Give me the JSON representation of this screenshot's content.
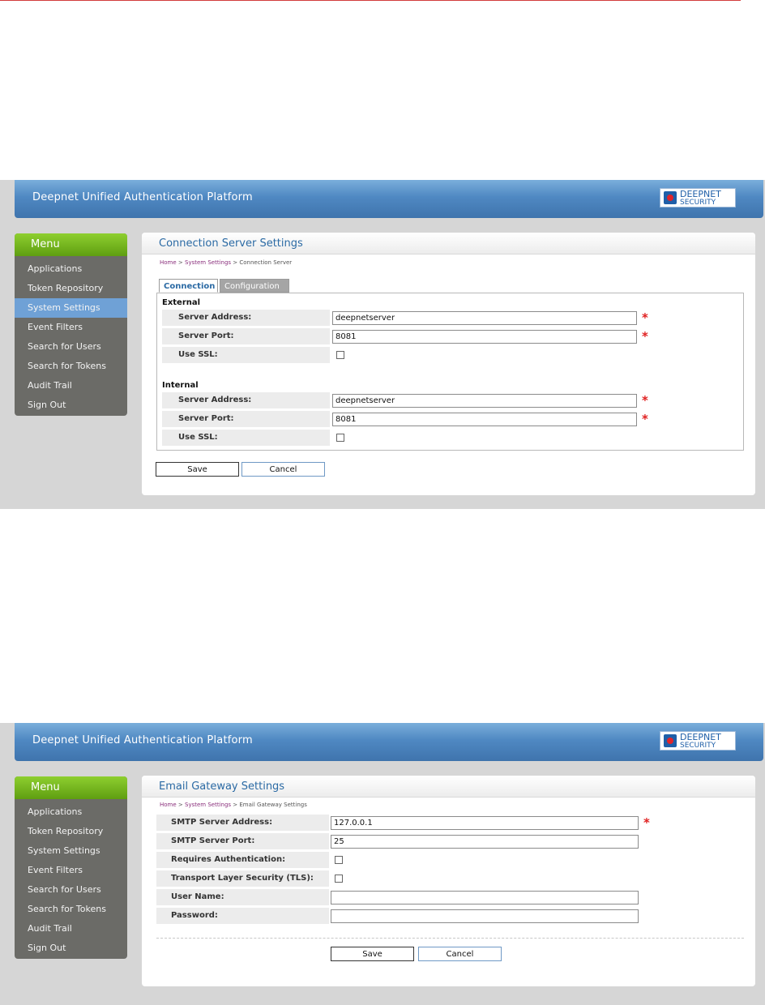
{
  "app_title": "Deepnet Unified Authentication Platform",
  "logo": {
    "line1": "DEEPNET",
    "line2": "SECURITY"
  },
  "menu": {
    "title": "Menu",
    "items": [
      "Applications",
      "Token Repository",
      "System Settings",
      "Event Filters",
      "Search for Users",
      "Search for Tokens",
      "Audit Trail",
      "Sign Out"
    ],
    "active_index_screen1": 2
  },
  "screen1": {
    "page_title": "Connection Server Settings",
    "breadcrumb": {
      "home": "Home",
      "sep": " > ",
      "section": "System Settings",
      "current": "Connection Server"
    },
    "tabs": [
      {
        "label": "Connection",
        "active": true
      },
      {
        "label": "Configuration",
        "active": false
      }
    ],
    "external": {
      "heading": "External",
      "server_address_label": "Server Address:",
      "server_address_value": "deepnetserver",
      "server_port_label": "Server Port:",
      "server_port_value": "8081",
      "use_ssl_label": "Use SSL:",
      "use_ssl_checked": false
    },
    "internal": {
      "heading": "Internal",
      "server_address_label": "Server Address:",
      "server_address_value": "deepnetserver",
      "server_port_label": "Server Port:",
      "server_port_value": "8081",
      "use_ssl_label": "Use SSL:",
      "use_ssl_checked": false
    },
    "required_mark": "*",
    "save_label": "Save",
    "cancel_label": "Cancel"
  },
  "screen2": {
    "page_title": "Email Gateway Settings",
    "breadcrumb": {
      "home": "Home",
      "sep": " > ",
      "section": "System Settings",
      "current": "Email Gateway Settings"
    },
    "smtp_address_label": "SMTP Server Address:",
    "smtp_address_value": "127.0.0.1",
    "smtp_port_label": "SMTP Server Port:",
    "smtp_port_value": "25",
    "requires_auth_label": "Requires Authentication:",
    "requires_auth_checked": false,
    "tls_label": "Transport Layer Security (TLS):",
    "tls_checked": false,
    "username_label": "User Name:",
    "username_value": "",
    "password_label": "Password:",
    "password_value": "",
    "required_mark": "*",
    "save_label": "Save",
    "cancel_label": "Cancel"
  },
  "colors": {
    "header_blue": "#4f88c2",
    "menu_green": "#6fb020",
    "menu_gray": "#6b6b67",
    "menu_active": "#6fa1d6",
    "title_blue": "#2b6aa4",
    "required_red": "#e02020"
  }
}
